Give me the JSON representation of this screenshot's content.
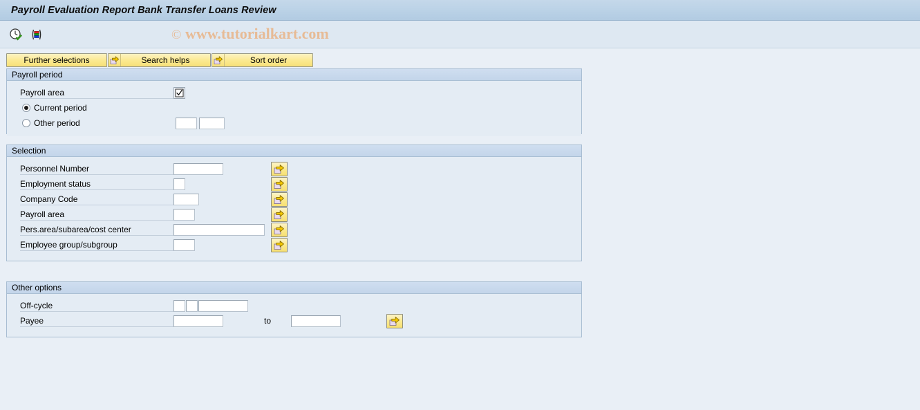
{
  "window": {
    "title": "Payroll Evaluation Report Bank Transfer Loans Review"
  },
  "watermark": {
    "copyright": "©",
    "text": "www.tutorialkart.com",
    "color": "#e7bb96"
  },
  "toolbar": {
    "icons": [
      {
        "name": "execute-clock-check-icon",
        "title": "Execute"
      },
      {
        "name": "multiple-selection-stripes-icon",
        "title": "Multiple selection"
      }
    ]
  },
  "button_bar": {
    "buttons": [
      {
        "label": "Further selections",
        "icon": ""
      },
      {
        "label": "Search helps",
        "icon": "yellow-arrow-icon"
      },
      {
        "label": "Sort order",
        "icon": "yellow-arrow-icon"
      }
    ]
  },
  "sections": {
    "payroll_period": {
      "title": "Payroll period",
      "payroll_area_label": "Payroll area",
      "payroll_area_checkbox_checked": true,
      "options": [
        {
          "label": "Current period",
          "selected": true
        },
        {
          "label": "Other period",
          "selected": false
        }
      ],
      "other_period_value_1": "",
      "other_period_value_2": ""
    },
    "selection": {
      "title": "Selection",
      "rows": [
        {
          "label": "Personnel Number",
          "value": "",
          "field_size": "i-xl"
        },
        {
          "label": "Employment status",
          "value": "",
          "field_size": "i-xs"
        },
        {
          "label": "Company Code",
          "value": "",
          "field_size": "i-md"
        },
        {
          "label": "Payroll area",
          "value": "",
          "field_size": "i-sm"
        },
        {
          "label": "Pers.area/subarea/cost center",
          "value": "",
          "field_size": "i-xxl"
        },
        {
          "label": "Employee group/subgroup",
          "value": "",
          "field_size": "i-sm"
        }
      ]
    },
    "other_options": {
      "title": "Other options",
      "offcycle_label": "Off-cycle",
      "offcycle_value_1": "",
      "offcycle_value_2": "",
      "offcycle_value_3": "",
      "payee_label": "Payee",
      "payee_from": "",
      "payee_to": "",
      "to_label": "to"
    }
  },
  "colors": {
    "background": "#e9eff6",
    "title_bar": "#bcd3e7",
    "group_header": "#c6d7eb",
    "group_body": "#e4ecf4",
    "button_yellow": "#fbe98f",
    "watermark": "#e7bb96"
  }
}
